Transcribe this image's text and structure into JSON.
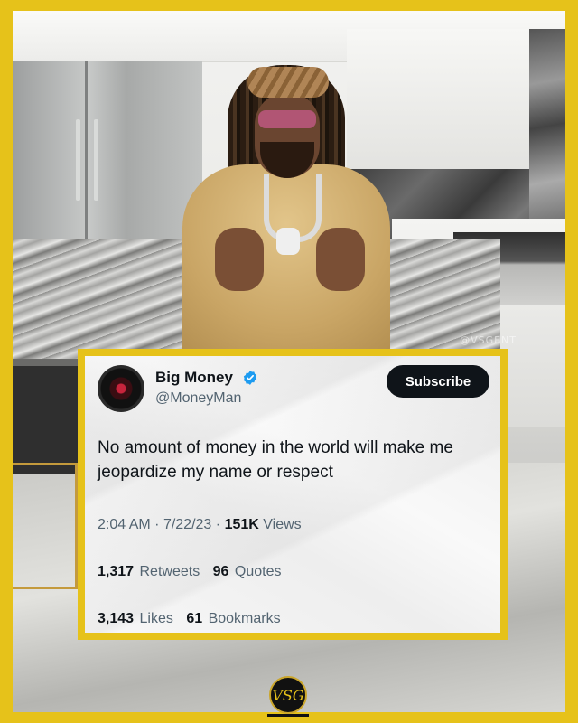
{
  "watermark": "@VSGENT",
  "tweet": {
    "display_name": "Big Money",
    "handle": "@MoneyMan",
    "subscribe_label": "Subscribe",
    "text": "No amount of money in the world will make me jeopardize my name or respect",
    "time": "2:04 AM",
    "date": "7/22/23",
    "views_count": "151K",
    "views_label": "Views",
    "retweets_count": "1,317",
    "retweets_label": "Retweets",
    "quotes_count": "96",
    "quotes_label": "Quotes",
    "likes_count": "3,143",
    "likes_label": "Likes",
    "bookmarks_count": "61",
    "bookmarks_label": "Bookmarks"
  },
  "brand_logo": "VSG",
  "colors": {
    "frame": "#e6c21a",
    "verified": "#1d9bf0",
    "subscribe_bg": "#0f1419"
  },
  "icons": [
    "verified-badge-icon"
  ]
}
